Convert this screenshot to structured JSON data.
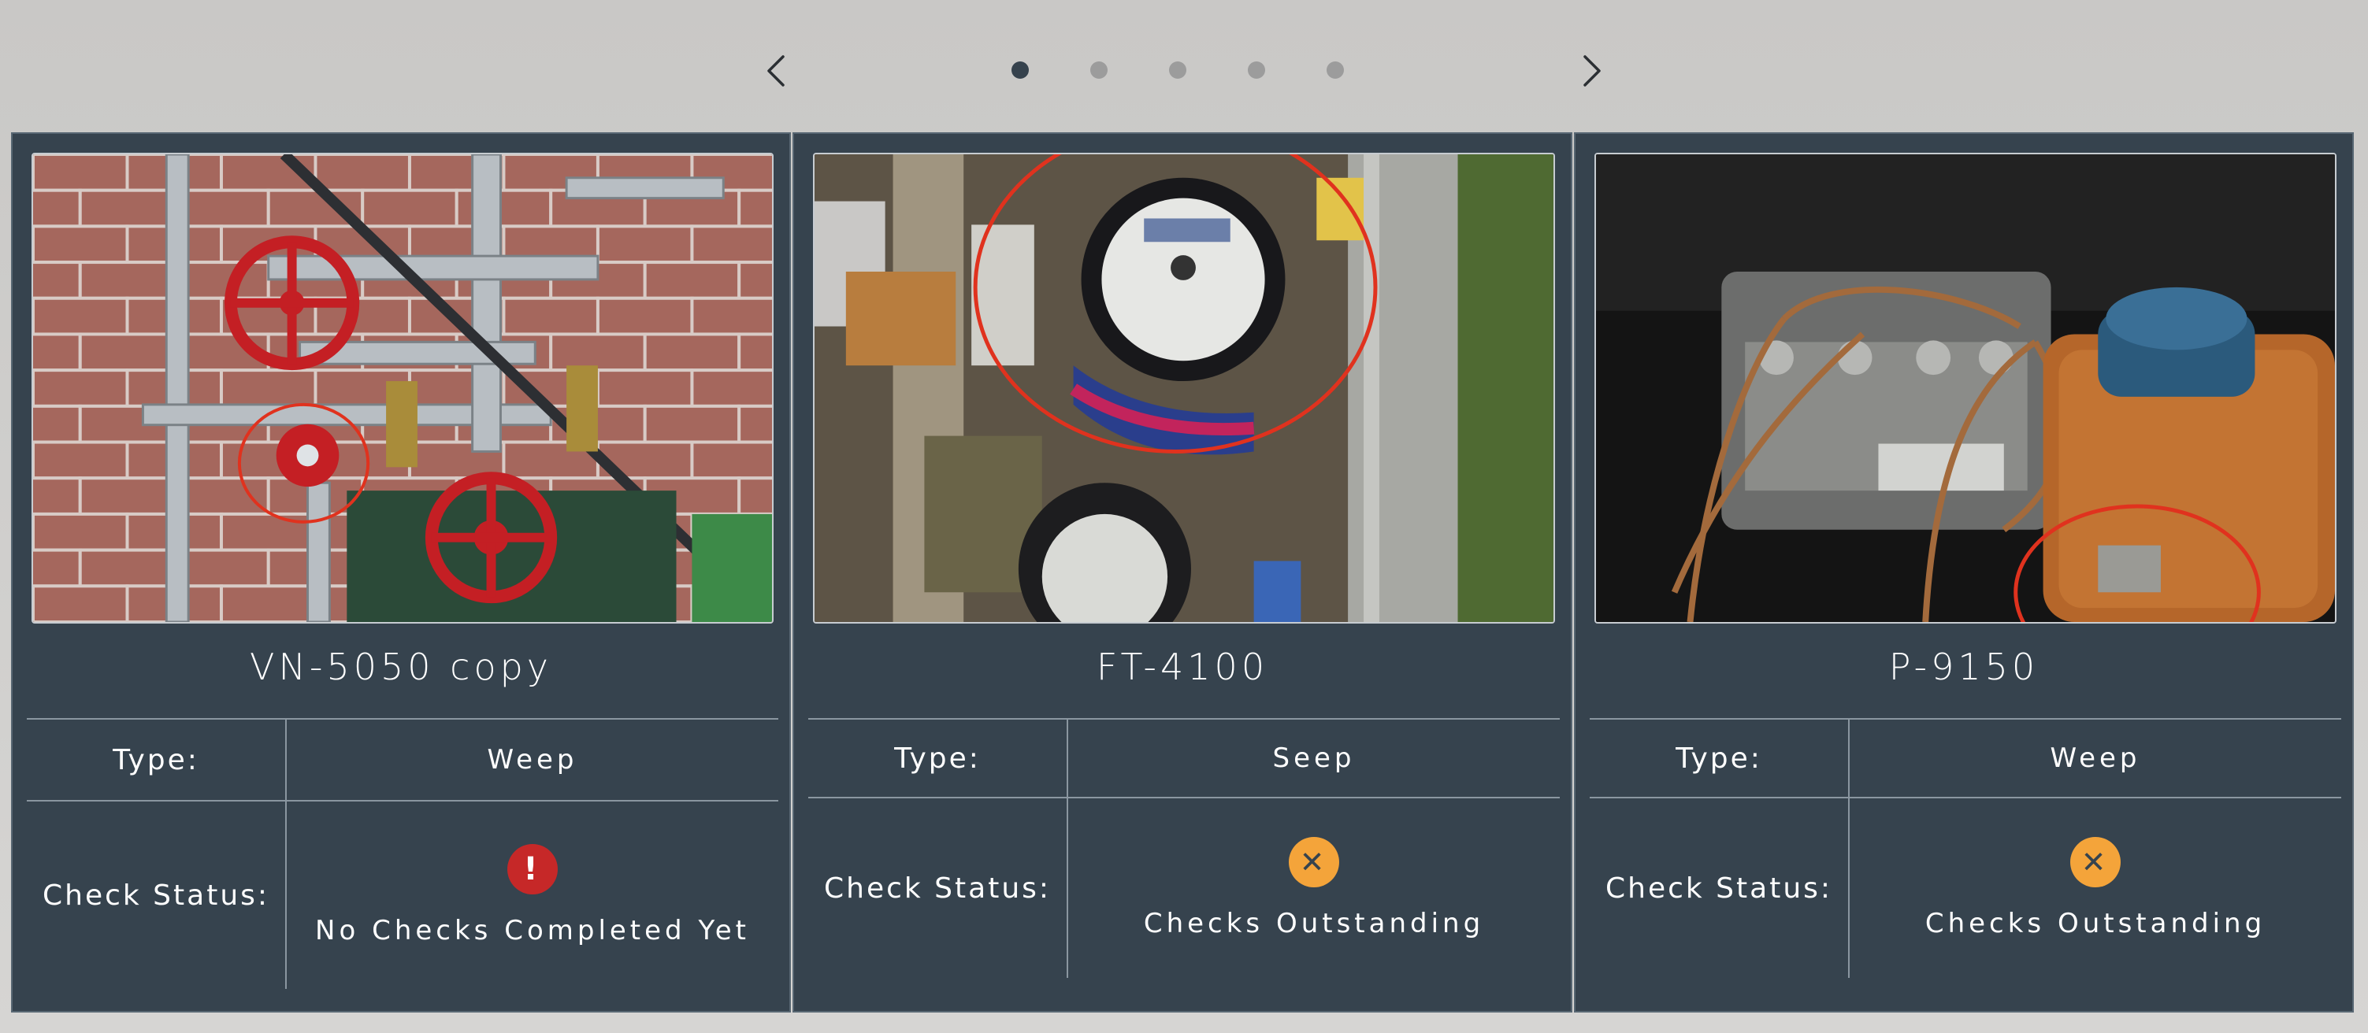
{
  "nav": {
    "prev_icon": "chevron-left-icon",
    "next_icon": "chevron-right-icon",
    "dots": [
      {
        "active": true
      },
      {
        "active": false
      },
      {
        "active": false
      },
      {
        "active": false
      },
      {
        "active": false
      }
    ]
  },
  "cards": [
    {
      "title": "VN-5050 copy",
      "type_label": "Type:",
      "type_value": "Weep",
      "status_label": "Check Status:",
      "status_icon": "exclamation-icon",
      "status_symbol": "!",
      "status_text": "No Checks Completed Yet",
      "status_color": "#c62828"
    },
    {
      "title": "FT-4100",
      "type_label": "Type:",
      "type_value": "Seep",
      "status_label": "Check Status:",
      "status_icon": "x-icon",
      "status_symbol": "✕",
      "status_text": "Checks Outstanding",
      "status_color": "#f4a43a"
    },
    {
      "title": "P-9150",
      "type_label": "Type:",
      "type_value": "Weep",
      "status_label": "Check Status:",
      "status_icon": "x-icon",
      "status_symbol": "✕",
      "status_text": "Checks Outstanding",
      "status_color": "#f4a43a"
    }
  ],
  "colors": {
    "card_bg": "#36434e",
    "page_bg": "#d0cfcd",
    "marker_circle": "#e0321e"
  }
}
